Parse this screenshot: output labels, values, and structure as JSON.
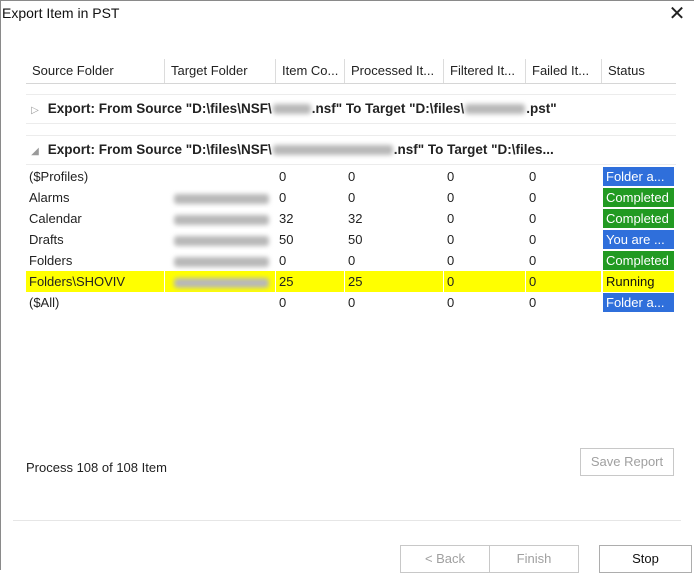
{
  "window": {
    "title": "Export Item in PST",
    "close_icon": "close-x-icon"
  },
  "grid": {
    "columns": [
      {
        "label": "Source Folder"
      },
      {
        "label": "Target Folder"
      },
      {
        "label": "Item Co..."
      },
      {
        "label": "Processed It..."
      },
      {
        "label": "Filtered It..."
      },
      {
        "label": "Failed It..."
      },
      {
        "label": "Status"
      }
    ],
    "groups": [
      {
        "expanded": false,
        "prefix": "Export: From Source \"D:\\files\\NSF\\",
        "mid": ".nsf\" To Target \"D:\\files\\",
        "suffix": ".pst\""
      },
      {
        "expanded": true,
        "prefix": "Export: From Source \"D:\\files\\NSF\\",
        "mid": ".nsf\" To Target \"D:\\files...",
        "suffix": ""
      }
    ],
    "rows": [
      {
        "source": "($Profiles)",
        "target_blurred": false,
        "item_count": "0",
        "processed": "0",
        "filtered": "0",
        "failed": "0",
        "status": "Folder a...",
        "status_color": "#2f6fdb",
        "highlight": false
      },
      {
        "source": "Alarms",
        "target_blurred": true,
        "item_count": "0",
        "processed": "0",
        "filtered": "0",
        "failed": "0",
        "status": "Completed",
        "status_color": "#229a22",
        "highlight": false
      },
      {
        "source": "Calendar",
        "target_blurred": true,
        "item_count": "32",
        "processed": "32",
        "filtered": "0",
        "failed": "0",
        "status": "Completed",
        "status_color": "#229a22",
        "highlight": false
      },
      {
        "source": "Drafts",
        "target_blurred": true,
        "item_count": "50",
        "processed": "50",
        "filtered": "0",
        "failed": "0",
        "status": "You are ...",
        "status_color": "#2f6fdb",
        "highlight": false
      },
      {
        "source": "Folders",
        "target_blurred": true,
        "item_count": "0",
        "processed": "0",
        "filtered": "0",
        "failed": "0",
        "status": "Completed",
        "status_color": "#229a22",
        "highlight": false
      },
      {
        "source": "Folders\\SHOVIV",
        "target_blurred": true,
        "item_count": "25",
        "processed": "25",
        "filtered": "0",
        "failed": "0",
        "status": "Running",
        "status_color": "#ffff00",
        "highlight": true
      },
      {
        "source": "($All)",
        "target_blurred": false,
        "item_count": "0",
        "processed": "0",
        "filtered": "0",
        "failed": "0",
        "status": "Folder a...",
        "status_color": "#2f6fdb",
        "highlight": false
      }
    ]
  },
  "footer": {
    "process_text": "Process 108 of 108 Item",
    "save_report": "Save Report",
    "back": "< Back",
    "finish": "Finish",
    "stop": "Stop"
  },
  "colors": {
    "highlight": "#ffff00",
    "status_blue": "#2f6fdb",
    "status_green": "#229a22"
  }
}
